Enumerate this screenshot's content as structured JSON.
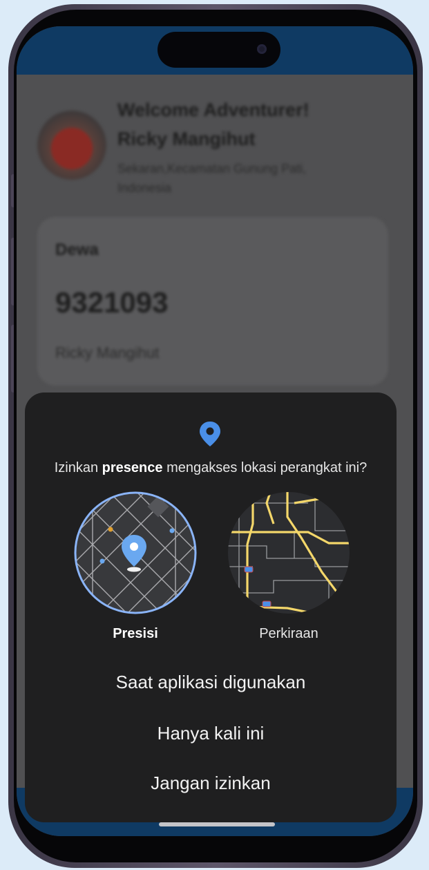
{
  "background_app": {
    "greeting": "Welcome Adventurer!",
    "user_name": "Ricky Mangihut",
    "location": "Sekaran,Kecamatan Gunung Pati, Indonesia",
    "card": {
      "label": "Dewa",
      "number": "9321093",
      "name": "Ricky Mangihut"
    }
  },
  "permission_dialog": {
    "icon": "location-pin-icon",
    "question_prefix": "Izinkan ",
    "app_name": "presence",
    "question_suffix": " mengakses lokasi perangkat ini?",
    "options": {
      "precise_label": "Presisi",
      "approximate_label": "Perkiraan",
      "selected": "Presisi"
    },
    "actions": {
      "while_using": "Saat aplikasi digunakan",
      "only_this_time": "Hanya kali ini",
      "deny": "Jangan izinkan"
    }
  },
  "colors": {
    "accent_blue": "#4a8fe8",
    "dialog_bg": "#1f1f20",
    "app_bar": "#0f3a63"
  }
}
